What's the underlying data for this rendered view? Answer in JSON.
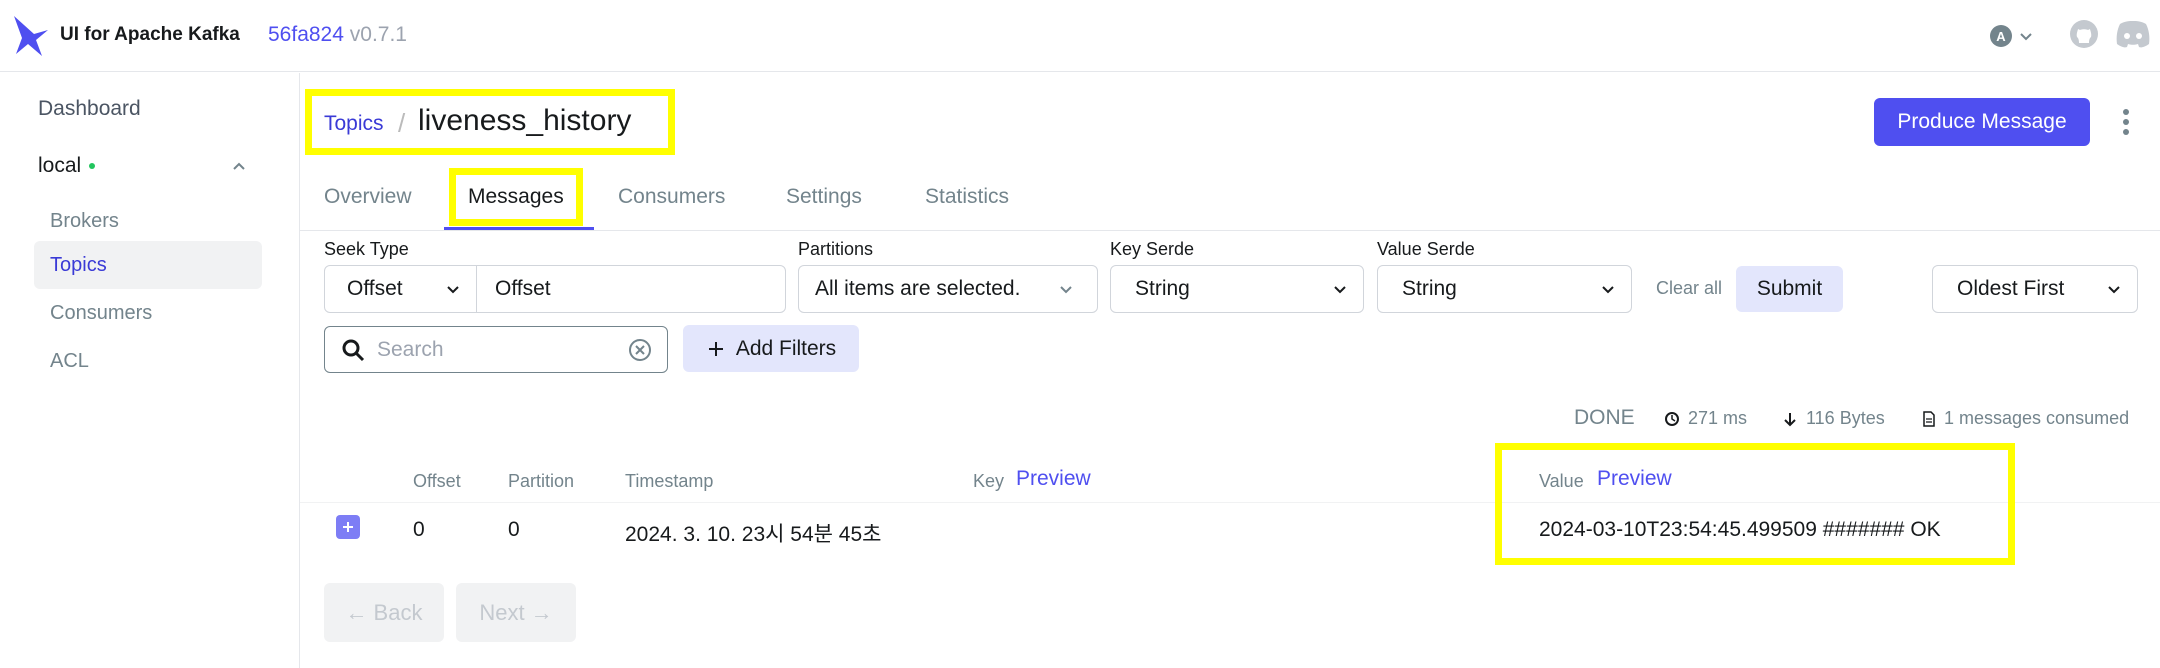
{
  "header": {
    "app_title": "UI for Apache Kafka",
    "commit_hash": "56fa824",
    "version": "v0.7.1",
    "user_initial": "A",
    "icons": [
      "logo-icon",
      "github-icon",
      "discord-icon"
    ]
  },
  "sidebar": {
    "dashboard": "Dashboard",
    "cluster": "local",
    "items": [
      {
        "label": "Brokers",
        "active": false
      },
      {
        "label": "Topics",
        "active": true
      },
      {
        "label": "Consumers",
        "active": false
      },
      {
        "label": "ACL",
        "active": false
      }
    ]
  },
  "breadcrumb": {
    "parent": "Topics",
    "separator": "/",
    "current": "liveness_history"
  },
  "toolbar": {
    "produce_label": "Produce Message"
  },
  "tabs": [
    {
      "label": "Overview",
      "active": false
    },
    {
      "label": "Messages",
      "active": true
    },
    {
      "label": "Consumers",
      "active": false
    },
    {
      "label": "Settings",
      "active": false
    },
    {
      "label": "Statistics",
      "active": false
    }
  ],
  "filters": {
    "seek_type_label": "Seek Type",
    "seek_type_value": "Offset",
    "offset_value": "Offset",
    "partitions_label": "Partitions",
    "partitions_value": "All items are selected.",
    "key_serde_label": "Key Serde",
    "key_serde_value": "String",
    "value_serde_label": "Value Serde",
    "value_serde_value": "String",
    "clear_all": "Clear all",
    "submit": "Submit",
    "sort_value": "Oldest First",
    "search_placeholder": "Search",
    "add_filters": "Add Filters"
  },
  "status": {
    "state": "DONE",
    "elapsed": "271 ms",
    "bytes": "116 Bytes",
    "consumed": "1 messages consumed"
  },
  "table": {
    "columns": {
      "offset": "Offset",
      "partition": "Partition",
      "timestamp": "Timestamp",
      "key": "Key",
      "key_preview": "Preview",
      "value": "Value",
      "value_preview": "Preview"
    },
    "rows": [
      {
        "offset": "0",
        "partition": "0",
        "timestamp": "2024. 3. 10. 23시 54분 45초",
        "key": "",
        "value": "2024-03-10T23:54:45.499509 ####### OK"
      }
    ]
  },
  "pagination": {
    "back": "Back",
    "next": "Next"
  },
  "colors": {
    "accent": "#4f4ff0",
    "highlight": "#ffff00",
    "online": "#22c55e"
  }
}
